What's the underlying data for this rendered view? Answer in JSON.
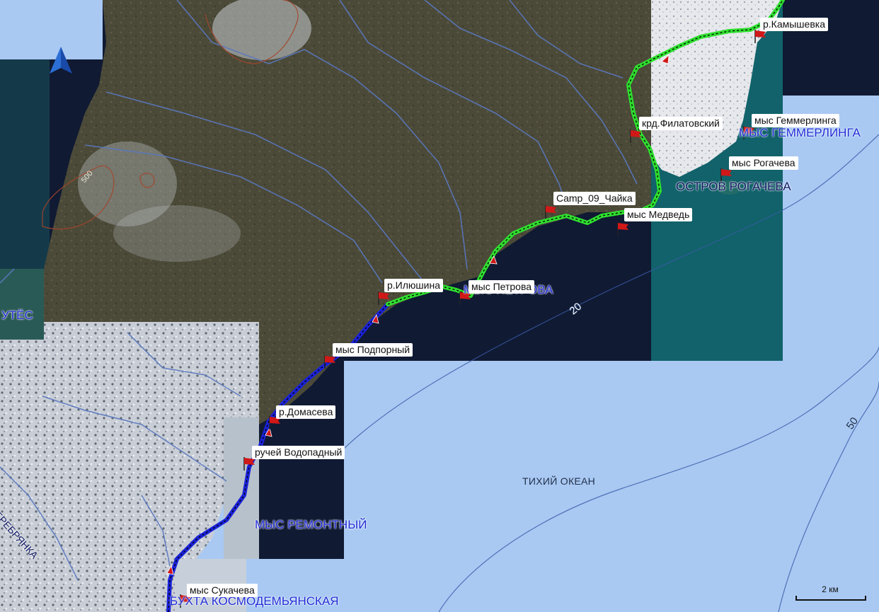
{
  "map": {
    "colors": {
      "ocean": "#a9c9f3",
      "deep_water": "#101a33",
      "land": "#4b4a38",
      "snow": "#dfe4ea",
      "track_green": "#2fe02f",
      "track_blue": "#1a22d9",
      "river": "#5a78c0",
      "flag_red": "#d01818",
      "label_blue": "#1f2bd6"
    },
    "waypoints": [
      {
        "id": "kamyshevka",
        "label": "р.Камышевка"
      },
      {
        "id": "filatovsky",
        "label": "крд.Филатовский"
      },
      {
        "id": "gemmerlinga",
        "label": "мыс Геммерлинга"
      },
      {
        "id": "rogacheva",
        "label": "мыс Рогачева"
      },
      {
        "id": "camp09",
        "label": "Camp_09_Чайка"
      },
      {
        "id": "medved",
        "label": "мыс Медведь"
      },
      {
        "id": "ilyushina",
        "label": "р.Илюшина"
      },
      {
        "id": "petrova",
        "label": "мыс Петрова"
      },
      {
        "id": "podporny",
        "label": "мыс Подпорный"
      },
      {
        "id": "domaseva",
        "label": "р.Домасева"
      },
      {
        "id": "vodopadny",
        "label": "ручей Водопадный"
      },
      {
        "id": "sukacheva",
        "label": "мыс Сукачева"
      }
    ],
    "features": {
      "cape_gemmerlinga": "МЫС ГЕММЕРЛИНГА",
      "island_rogacheva": "ОСТРОВ РОГАЧЕВА",
      "cape_petrova_bg": "МЫС ПЕТРОВА",
      "cape_remontny": "МЫС РЕМОНТНЫЙ",
      "bay_kosmodemyanskaya": "БУХТА КОСМОДЕМЬЯНСКАЯ",
      "utes": "УТЁС",
      "serebryanka": "СЕРЕБРЯНКА"
    },
    "ocean_label": "ТИХИЙ ОКЕАН",
    "depths": {
      "d20": "20",
      "d50": "50"
    },
    "contour_label": "500",
    "scale_label": "2 км"
  }
}
